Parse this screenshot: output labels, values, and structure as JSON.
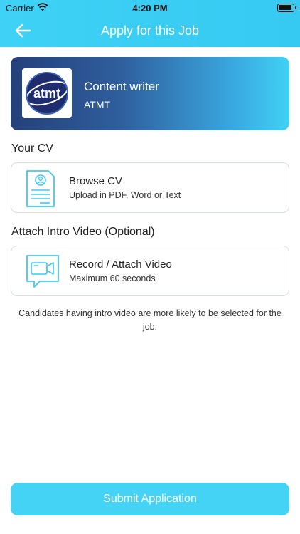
{
  "status_bar": {
    "carrier": "Carrier",
    "time": "4:20 PM"
  },
  "nav": {
    "title": "Apply for this Job",
    "back_icon": "arrow-left-icon"
  },
  "job": {
    "title": "Content writer",
    "company": "ATMT",
    "logo_text": "atmt"
  },
  "cv_section": {
    "label": "Your CV",
    "option_title": "Browse CV",
    "option_subtitle": "Upload in PDF, Word or Text",
    "icon": "resume-document-icon"
  },
  "video_section": {
    "label": "Attach Intro Video (Optional)",
    "option_title": "Record / Attach Video",
    "option_subtitle": "Maximum 60 seconds",
    "icon": "video-camera-chat-icon"
  },
  "hint": "Candidates having intro video are more likely to be selected for the job.",
  "submit_label": "Submit Application",
  "colors": {
    "header": "#3fd2f6",
    "accent": "#45d3f5",
    "icon_stroke": "#3ccbf0"
  }
}
